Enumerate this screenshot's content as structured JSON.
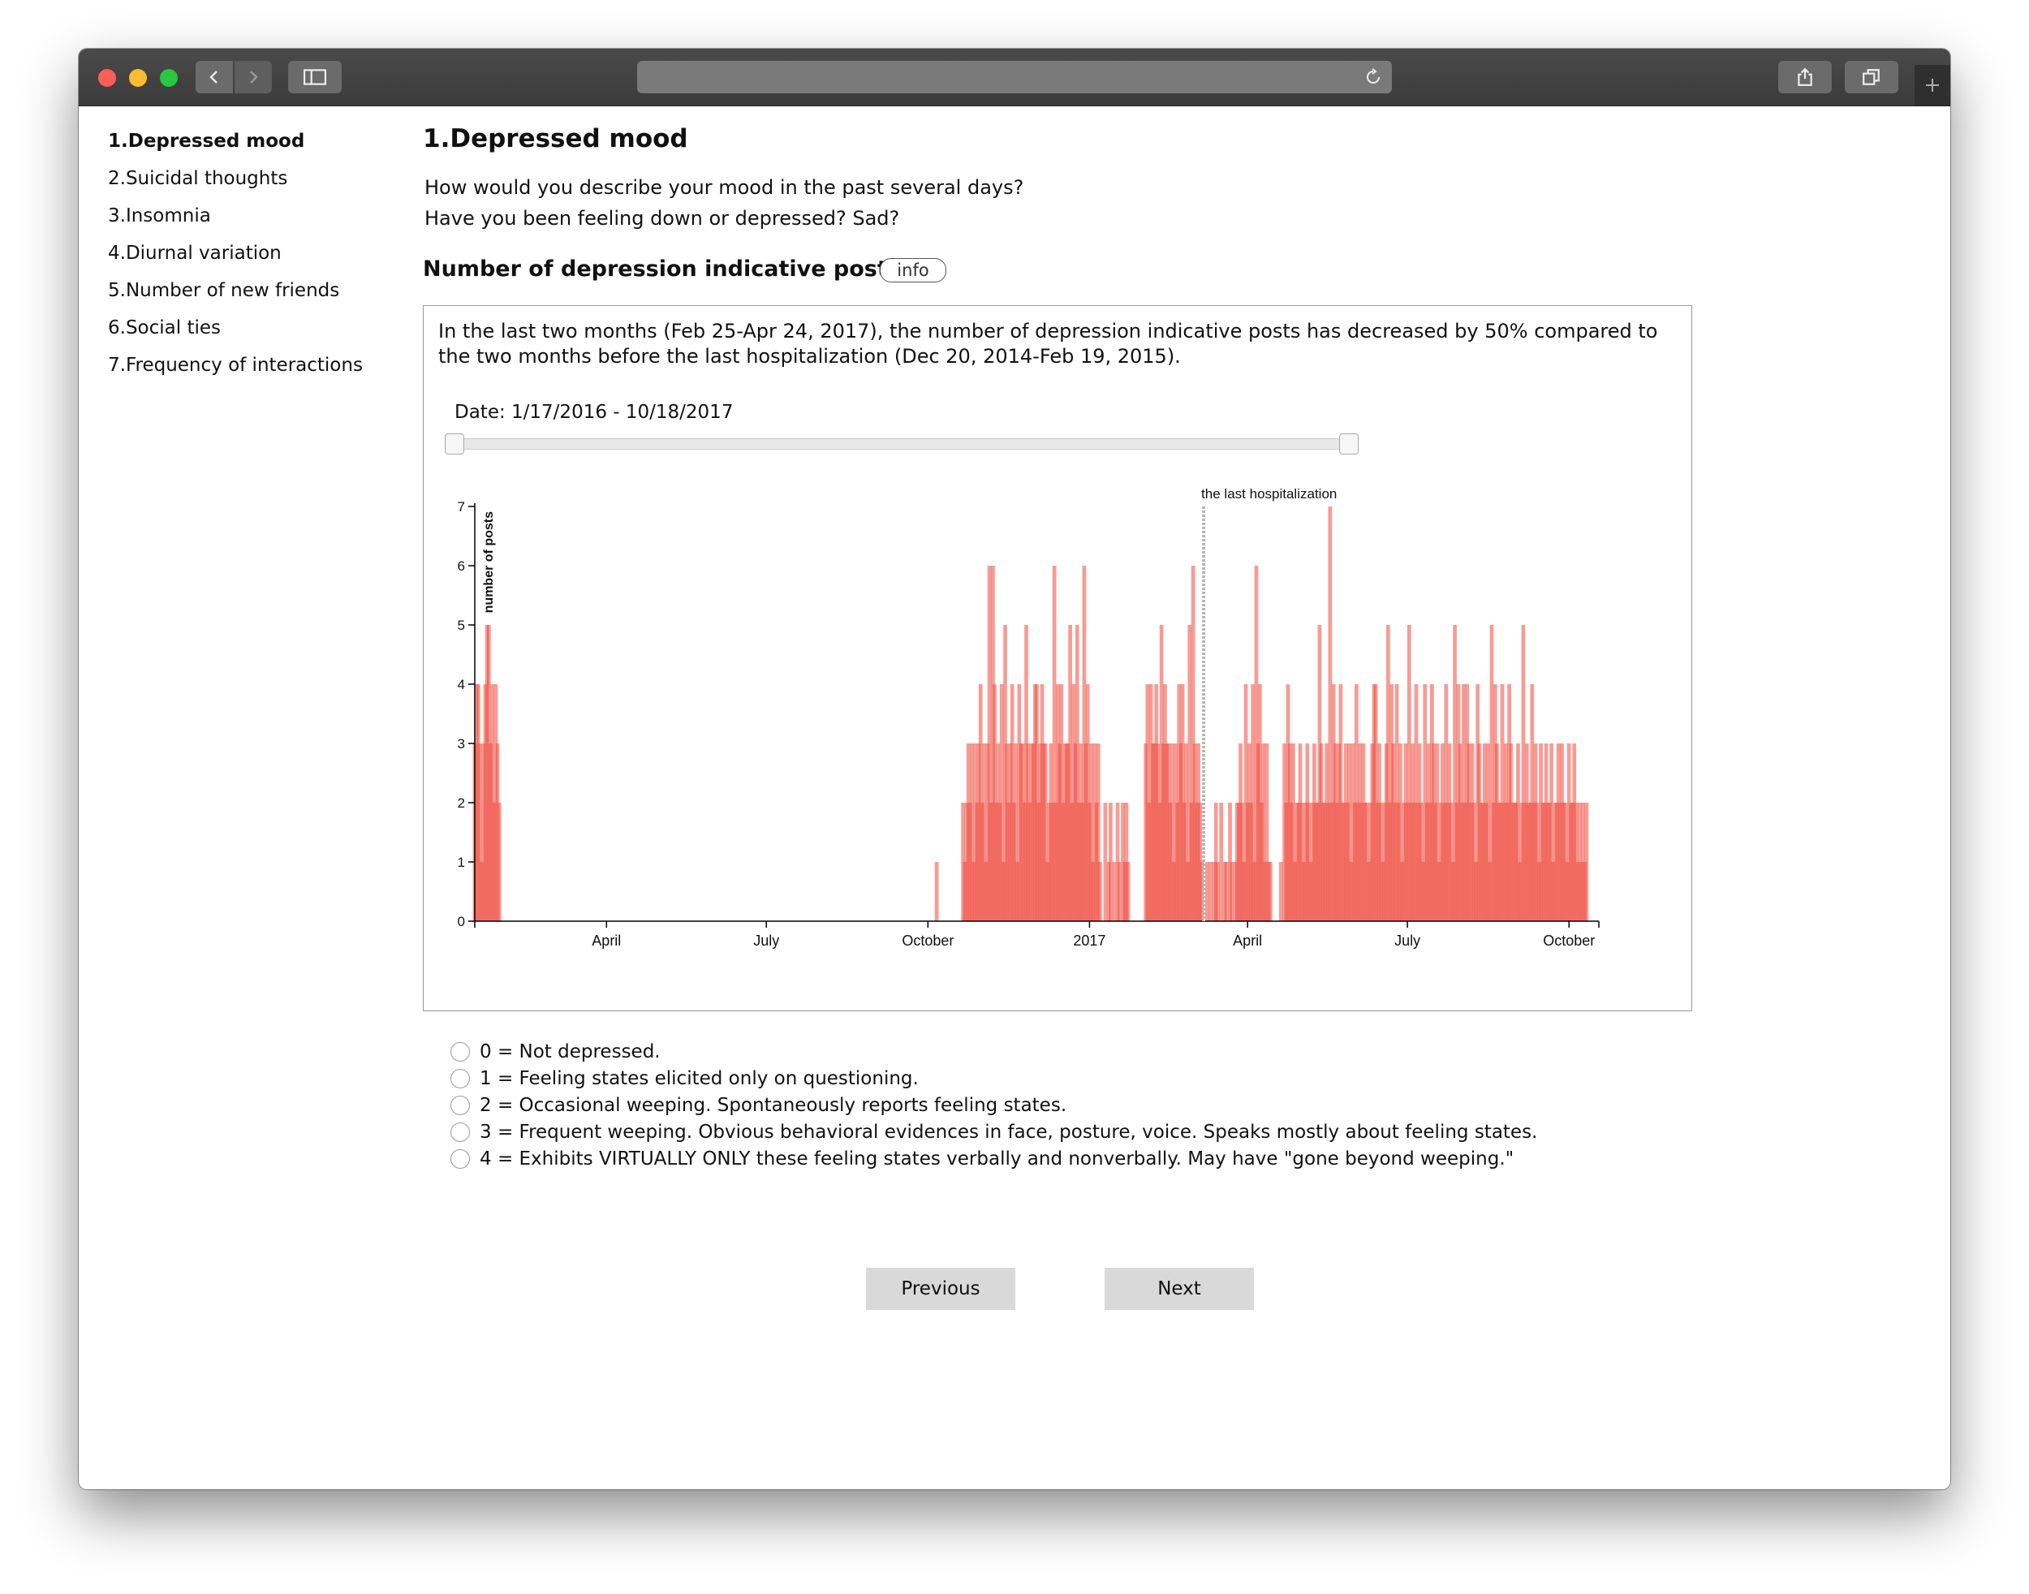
{
  "nav": {
    "items": [
      {
        "label": "1.Depressed mood",
        "active": true
      },
      {
        "label": "2.Suicidal thoughts",
        "active": false
      },
      {
        "label": "3.Insomnia",
        "active": false
      },
      {
        "label": "4.Diurnal variation",
        "active": false
      },
      {
        "label": "5.Number of new friends",
        "active": false
      },
      {
        "label": "6.Social ties",
        "active": false
      },
      {
        "label": "7.Frequency of interactions",
        "active": false
      }
    ]
  },
  "main": {
    "title": "1.Depressed mood",
    "question_line1": "How would you describe your mood in the past several days?",
    "question_line2": "Have you been feeling down or depressed? Sad?",
    "section_title": "Number of depression indicative posts",
    "info_label": "info",
    "summary": "In the last two months (Feb 25-Apr 24, 2017), the number of depression indicative posts has decreased by 50% compared to the two months before the last hospitalization (Dec 20, 2014-Feb 19, 2015).",
    "date_range_label": "Date: 1/17/2016 - 10/18/2017"
  },
  "chart_data": {
    "type": "bar",
    "ylabel": "number of posts",
    "ylim": [
      0,
      7
    ],
    "yticks": [
      "0",
      "1",
      "2",
      "3",
      "4",
      "5",
      "6",
      "7"
    ],
    "xlim": [
      "2016-01-17",
      "2017-10-18"
    ],
    "xticks": [
      {
        "date": "2016-04-01",
        "label": "April"
      },
      {
        "date": "2016-07-01",
        "label": "July"
      },
      {
        "date": "2016-10-01",
        "label": "October"
      },
      {
        "date": "2017-01-01",
        "label": "2017"
      },
      {
        "date": "2017-04-01",
        "label": "April"
      },
      {
        "date": "2017-07-01",
        "label": "July"
      },
      {
        "date": "2017-10-01",
        "label": "October"
      }
    ],
    "annotation": {
      "date": "2017-03-07",
      "label": "the last hospitalization"
    },
    "bar_color": "#ee4a3e",
    "posts": [
      [
        "2016-01-17",
        3
      ],
      [
        "2016-01-18",
        4
      ],
      [
        "2016-01-19",
        4
      ],
      [
        "2016-01-20",
        3
      ],
      [
        "2016-01-21",
        1
      ],
      [
        "2016-01-22",
        3
      ],
      [
        "2016-01-23",
        4
      ],
      [
        "2016-01-24",
        5
      ],
      [
        "2016-01-25",
        5
      ],
      [
        "2016-01-26",
        3
      ],
      [
        "2016-01-27",
        4
      ],
      [
        "2016-01-28",
        2
      ],
      [
        "2016-01-29",
        4
      ],
      [
        "2016-01-30",
        3
      ],
      [
        "2016-01-31",
        2
      ],
      [
        "2016-10-06",
        1
      ],
      [
        "2016-10-21",
        2
      ],
      [
        "2016-10-22",
        1
      ],
      [
        "2016-10-23",
        2
      ],
      [
        "2016-10-24",
        3
      ],
      [
        "2016-10-25",
        2
      ],
      [
        "2016-10-26",
        3
      ],
      [
        "2016-10-27",
        1
      ],
      [
        "2016-10-28",
        3
      ],
      [
        "2016-10-29",
        2
      ],
      [
        "2016-10-30",
        3
      ],
      [
        "2016-10-31",
        4
      ],
      [
        "2016-11-01",
        2
      ],
      [
        "2016-11-02",
        3
      ],
      [
        "2016-11-03",
        1
      ],
      [
        "2016-11-04",
        3
      ],
      [
        "2016-11-05",
        6
      ],
      [
        "2016-11-06",
        2
      ],
      [
        "2016-11-07",
        6
      ],
      [
        "2016-11-08",
        4
      ],
      [
        "2016-11-09",
        2
      ],
      [
        "2016-11-10",
        3
      ],
      [
        "2016-11-11",
        2
      ],
      [
        "2016-11-12",
        4
      ],
      [
        "2016-11-13",
        1
      ],
      [
        "2016-11-14",
        5
      ],
      [
        "2016-11-15",
        3
      ],
      [
        "2016-11-16",
        2
      ],
      [
        "2016-11-17",
        3
      ],
      [
        "2016-11-18",
        4
      ],
      [
        "2016-11-19",
        2
      ],
      [
        "2016-11-20",
        3
      ],
      [
        "2016-11-21",
        1
      ],
      [
        "2016-11-22",
        4
      ],
      [
        "2016-11-23",
        3
      ],
      [
        "2016-11-24",
        3
      ],
      [
        "2016-11-25",
        2
      ],
      [
        "2016-11-26",
        5
      ],
      [
        "2016-11-27",
        3
      ],
      [
        "2016-11-28",
        2
      ],
      [
        "2016-11-29",
        3
      ],
      [
        "2016-11-30",
        3
      ],
      [
        "2016-12-01",
        4
      ],
      [
        "2016-12-02",
        4
      ],
      [
        "2016-12-03",
        2
      ],
      [
        "2016-12-04",
        3
      ],
      [
        "2016-12-05",
        4
      ],
      [
        "2016-12-06",
        3
      ],
      [
        "2016-12-07",
        3
      ],
      [
        "2016-12-08",
        1
      ],
      [
        "2016-12-09",
        2
      ],
      [
        "2016-12-10",
        3
      ],
      [
        "2016-12-11",
        2
      ],
      [
        "2016-12-12",
        6
      ],
      [
        "2016-12-13",
        2
      ],
      [
        "2016-12-14",
        4
      ],
      [
        "2016-12-15",
        3
      ],
      [
        "2016-12-16",
        4
      ],
      [
        "2016-12-17",
        2
      ],
      [
        "2016-12-18",
        3
      ],
      [
        "2016-12-19",
        3
      ],
      [
        "2016-12-20",
        3
      ],
      [
        "2016-12-21",
        5
      ],
      [
        "2016-12-22",
        2
      ],
      [
        "2016-12-23",
        4
      ],
      [
        "2016-12-24",
        3
      ],
      [
        "2016-12-25",
        5
      ],
      [
        "2016-12-26",
        2
      ],
      [
        "2016-12-27",
        3
      ],
      [
        "2016-12-28",
        2
      ],
      [
        "2016-12-29",
        6
      ],
      [
        "2016-12-30",
        3
      ],
      [
        "2016-12-31",
        4
      ],
      [
        "2017-01-01",
        2
      ],
      [
        "2017-01-02",
        3
      ],
      [
        "2017-01-03",
        1
      ],
      [
        "2017-01-04",
        3
      ],
      [
        "2017-01-05",
        2
      ],
      [
        "2017-01-06",
        3
      ],
      [
        "2017-01-07",
        1
      ],
      [
        "2017-01-10",
        2
      ],
      [
        "2017-01-12",
        1
      ],
      [
        "2017-01-13",
        2
      ],
      [
        "2017-01-15",
        1
      ],
      [
        "2017-01-17",
        2
      ],
      [
        "2017-01-18",
        1
      ],
      [
        "2017-01-20",
        2
      ],
      [
        "2017-01-21",
        1
      ],
      [
        "2017-01-22",
        2
      ],
      [
        "2017-01-23",
        1
      ],
      [
        "2017-02-02",
        3
      ],
      [
        "2017-02-03",
        4
      ],
      [
        "2017-02-04",
        2
      ],
      [
        "2017-02-05",
        4
      ],
      [
        "2017-02-06",
        3
      ],
      [
        "2017-02-07",
        3
      ],
      [
        "2017-02-08",
        4
      ],
      [
        "2017-02-09",
        3
      ],
      [
        "2017-02-10",
        2
      ],
      [
        "2017-02-11",
        5
      ],
      [
        "2017-02-12",
        3
      ],
      [
        "2017-02-13",
        4
      ],
      [
        "2017-02-14",
        3
      ],
      [
        "2017-02-15",
        3
      ],
      [
        "2017-02-16",
        2
      ],
      [
        "2017-02-17",
        3
      ],
      [
        "2017-02-18",
        1
      ],
      [
        "2017-02-19",
        3
      ],
      [
        "2017-02-20",
        2
      ],
      [
        "2017-02-21",
        4
      ],
      [
        "2017-02-22",
        3
      ],
      [
        "2017-02-23",
        4
      ],
      [
        "2017-02-24",
        2
      ],
      [
        "2017-02-25",
        3
      ],
      [
        "2017-02-26",
        1
      ],
      [
        "2017-02-27",
        5
      ],
      [
        "2017-02-28",
        2
      ],
      [
        "2017-03-01",
        6
      ],
      [
        "2017-03-02",
        3
      ],
      [
        "2017-03-03",
        2
      ],
      [
        "2017-03-04",
        3
      ],
      [
        "2017-03-05",
        2
      ],
      [
        "2017-03-06",
        1
      ],
      [
        "2017-03-09",
        1
      ],
      [
        "2017-03-11",
        1
      ],
      [
        "2017-03-13",
        1
      ],
      [
        "2017-03-14",
        2
      ],
      [
        "2017-03-15",
        1
      ],
      [
        "2017-03-17",
        2
      ],
      [
        "2017-03-19",
        1
      ],
      [
        "2017-03-20",
        1
      ],
      [
        "2017-03-22",
        2
      ],
      [
        "2017-03-23",
        1
      ],
      [
        "2017-03-25",
        1
      ],
      [
        "2017-03-26",
        2
      ],
      [
        "2017-03-27",
        2
      ],
      [
        "2017-03-28",
        3
      ],
      [
        "2017-03-29",
        2
      ],
      [
        "2017-03-30",
        1
      ],
      [
        "2017-03-31",
        4
      ],
      [
        "2017-04-01",
        2
      ],
      [
        "2017-04-02",
        3
      ],
      [
        "2017-04-03",
        2
      ],
      [
        "2017-04-04",
        4
      ],
      [
        "2017-04-05",
        1
      ],
      [
        "2017-04-06",
        6
      ],
      [
        "2017-04-07",
        3
      ],
      [
        "2017-04-08",
        4
      ],
      [
        "2017-04-09",
        2
      ],
      [
        "2017-04-10",
        3
      ],
      [
        "2017-04-11",
        1
      ],
      [
        "2017-04-12",
        3
      ],
      [
        "2017-04-13",
        1
      ],
      [
        "2017-04-14",
        1
      ],
      [
        "2017-04-20",
        1
      ],
      [
        "2017-04-22",
        3
      ],
      [
        "2017-04-23",
        2
      ],
      [
        "2017-04-24",
        4
      ],
      [
        "2017-04-25",
        3
      ],
      [
        "2017-04-26",
        2
      ],
      [
        "2017-04-27",
        3
      ],
      [
        "2017-04-28",
        1
      ],
      [
        "2017-04-29",
        2
      ],
      [
        "2017-04-30",
        2
      ],
      [
        "2017-05-01",
        3
      ],
      [
        "2017-05-02",
        2
      ],
      [
        "2017-05-03",
        1
      ],
      [
        "2017-05-04",
        2
      ],
      [
        "2017-05-05",
        3
      ],
      [
        "2017-05-06",
        2
      ],
      [
        "2017-05-07",
        1
      ],
      [
        "2017-05-08",
        2
      ],
      [
        "2017-05-09",
        3
      ],
      [
        "2017-05-10",
        2
      ],
      [
        "2017-05-11",
        2
      ],
      [
        "2017-05-12",
        5
      ],
      [
        "2017-05-13",
        3
      ],
      [
        "2017-05-14",
        2
      ],
      [
        "2017-05-15",
        2
      ],
      [
        "2017-05-16",
        3
      ],
      [
        "2017-05-17",
        2
      ],
      [
        "2017-05-18",
        7
      ],
      [
        "2017-05-19",
        2
      ],
      [
        "2017-05-20",
        4
      ],
      [
        "2017-05-21",
        3
      ],
      [
        "2017-05-22",
        2
      ],
      [
        "2017-05-23",
        3
      ],
      [
        "2017-05-24",
        4
      ],
      [
        "2017-05-25",
        2
      ],
      [
        "2017-05-26",
        2
      ],
      [
        "2017-05-27",
        3
      ],
      [
        "2017-05-28",
        2
      ],
      [
        "2017-05-29",
        3
      ],
      [
        "2017-05-30",
        1
      ],
      [
        "2017-05-31",
        3
      ],
      [
        "2017-06-01",
        2
      ],
      [
        "2017-06-02",
        4
      ],
      [
        "2017-06-03",
        2
      ],
      [
        "2017-06-04",
        3
      ],
      [
        "2017-06-05",
        2
      ],
      [
        "2017-06-06",
        3
      ],
      [
        "2017-06-07",
        2
      ],
      [
        "2017-06-08",
        2
      ],
      [
        "2017-06-09",
        1
      ],
      [
        "2017-06-10",
        2
      ],
      [
        "2017-06-11",
        3
      ],
      [
        "2017-06-12",
        4
      ],
      [
        "2017-06-13",
        4
      ],
      [
        "2017-06-14",
        2
      ],
      [
        "2017-06-15",
        3
      ],
      [
        "2017-06-16",
        2
      ],
      [
        "2017-06-17",
        1
      ],
      [
        "2017-06-18",
        2
      ],
      [
        "2017-06-19",
        3
      ],
      [
        "2017-06-20",
        5
      ],
      [
        "2017-06-21",
        2
      ],
      [
        "2017-06-22",
        4
      ],
      [
        "2017-06-23",
        3
      ],
      [
        "2017-06-24",
        2
      ],
      [
        "2017-06-25",
        4
      ],
      [
        "2017-06-26",
        2
      ],
      [
        "2017-06-27",
        3
      ],
      [
        "2017-06-28",
        1
      ],
      [
        "2017-06-29",
        2
      ],
      [
        "2017-06-30",
        3
      ],
      [
        "2017-07-01",
        2
      ],
      [
        "2017-07-02",
        5
      ],
      [
        "2017-07-03",
        2
      ],
      [
        "2017-07-04",
        3
      ],
      [
        "2017-07-05",
        2
      ],
      [
        "2017-07-06",
        4
      ],
      [
        "2017-07-07",
        2
      ],
      [
        "2017-07-08",
        3
      ],
      [
        "2017-07-09",
        2
      ],
      [
        "2017-07-10",
        1
      ],
      [
        "2017-07-11",
        4
      ],
      [
        "2017-07-12",
        2
      ],
      [
        "2017-07-13",
        3
      ],
      [
        "2017-07-14",
        2
      ],
      [
        "2017-07-15",
        4
      ],
      [
        "2017-07-16",
        3
      ],
      [
        "2017-07-17",
        2
      ],
      [
        "2017-07-18",
        3
      ],
      [
        "2017-07-19",
        1
      ],
      [
        "2017-07-20",
        2
      ],
      [
        "2017-07-21",
        3
      ],
      [
        "2017-07-22",
        2
      ],
      [
        "2017-07-23",
        4
      ],
      [
        "2017-07-24",
        2
      ],
      [
        "2017-07-25",
        3
      ],
      [
        "2017-07-26",
        2
      ],
      [
        "2017-07-27",
        1
      ],
      [
        "2017-07-28",
        5
      ],
      [
        "2017-07-29",
        2
      ],
      [
        "2017-07-30",
        4
      ],
      [
        "2017-07-31",
        3
      ],
      [
        "2017-08-01",
        2
      ],
      [
        "2017-08-02",
        4
      ],
      [
        "2017-08-03",
        2
      ],
      [
        "2017-08-04",
        4
      ],
      [
        "2017-08-05",
        3
      ],
      [
        "2017-08-06",
        2
      ],
      [
        "2017-08-07",
        3
      ],
      [
        "2017-08-08",
        2
      ],
      [
        "2017-08-09",
        1
      ],
      [
        "2017-08-10",
        4
      ],
      [
        "2017-08-11",
        3
      ],
      [
        "2017-08-12",
        2
      ],
      [
        "2017-08-13",
        2
      ],
      [
        "2017-08-14",
        3
      ],
      [
        "2017-08-15",
        2
      ],
      [
        "2017-08-16",
        3
      ],
      [
        "2017-08-17",
        1
      ],
      [
        "2017-08-18",
        5
      ],
      [
        "2017-08-19",
        2
      ],
      [
        "2017-08-20",
        4
      ],
      [
        "2017-08-21",
        3
      ],
      [
        "2017-08-22",
        2
      ],
      [
        "2017-08-23",
        2
      ],
      [
        "2017-08-24",
        4
      ],
      [
        "2017-08-25",
        2
      ],
      [
        "2017-08-26",
        3
      ],
      [
        "2017-08-27",
        2
      ],
      [
        "2017-08-28",
        4
      ],
      [
        "2017-08-29",
        3
      ],
      [
        "2017-08-30",
        2
      ],
      [
        "2017-08-31",
        2
      ],
      [
        "2017-09-01",
        2
      ],
      [
        "2017-09-02",
        3
      ],
      [
        "2017-09-03",
        1
      ],
      [
        "2017-09-04",
        2
      ],
      [
        "2017-09-05",
        5
      ],
      [
        "2017-09-06",
        2
      ],
      [
        "2017-09-07",
        3
      ],
      [
        "2017-09-08",
        2
      ],
      [
        "2017-09-09",
        2
      ],
      [
        "2017-09-10",
        4
      ],
      [
        "2017-09-11",
        2
      ],
      [
        "2017-09-12",
        3
      ],
      [
        "2017-09-13",
        2
      ],
      [
        "2017-09-14",
        1
      ],
      [
        "2017-09-15",
        3
      ],
      [
        "2017-09-16",
        2
      ],
      [
        "2017-09-17",
        2
      ],
      [
        "2017-09-18",
        3
      ],
      [
        "2017-09-19",
        2
      ],
      [
        "2017-09-20",
        2
      ],
      [
        "2017-09-21",
        3
      ],
      [
        "2017-09-22",
        1
      ],
      [
        "2017-09-23",
        2
      ],
      [
        "2017-09-24",
        2
      ],
      [
        "2017-09-25",
        3
      ],
      [
        "2017-09-26",
        2
      ],
      [
        "2017-09-27",
        3
      ],
      [
        "2017-09-28",
        2
      ],
      [
        "2017-09-29",
        2
      ],
      [
        "2017-09-30",
        1
      ],
      [
        "2017-10-01",
        3
      ],
      [
        "2017-10-02",
        2
      ],
      [
        "2017-10-03",
        2
      ],
      [
        "2017-10-04",
        3
      ],
      [
        "2017-10-05",
        2
      ],
      [
        "2017-10-06",
        1
      ],
      [
        "2017-10-07",
        2
      ],
      [
        "2017-10-08",
        1
      ],
      [
        "2017-10-09",
        2
      ],
      [
        "2017-10-10",
        1
      ],
      [
        "2017-10-11",
        2
      ]
    ]
  },
  "options": [
    {
      "label": "0 = Not depressed."
    },
    {
      "label": "1 = Feeling states elicited only on questioning."
    },
    {
      "label": "2 = Occasional weeping. Spontaneously reports feeling states."
    },
    {
      "label": "3 = Frequent weeping. Obvious behavioral evidences in face, posture, voice. Speaks mostly about feeling states."
    },
    {
      "label": "4 = Exhibits VIRTUALLY ONLY these feeling states verbally and nonverbally. May have \"gone beyond weeping.\""
    }
  ],
  "buttons": {
    "previous": "Previous",
    "next": "Next"
  }
}
